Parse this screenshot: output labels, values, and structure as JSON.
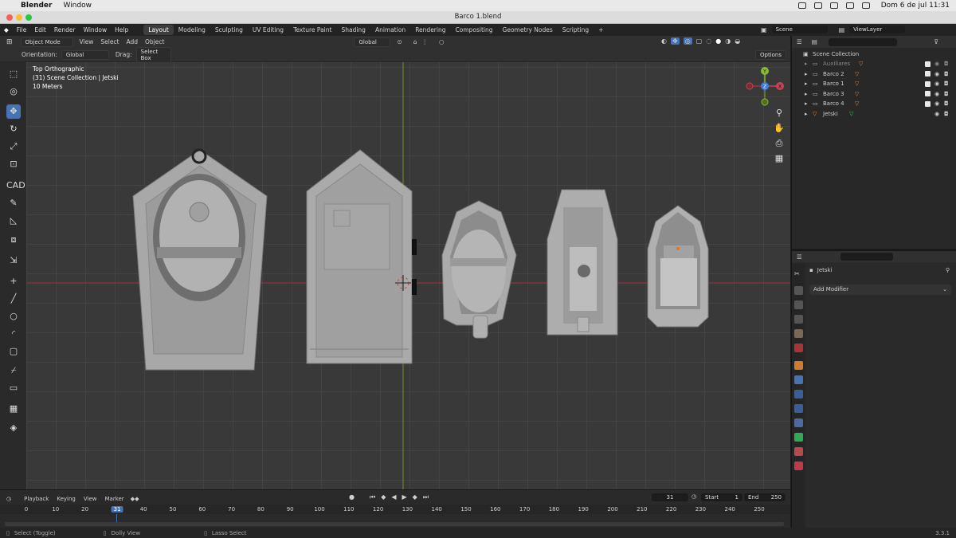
{
  "os_menubar": {
    "app_name": "Blender",
    "menu": "Window",
    "clock": "Dom 6 de jul  11:31"
  },
  "window": {
    "title": "Barco 1.blend"
  },
  "topbar": {
    "menus": [
      "File",
      "Edit",
      "Render",
      "Window",
      "Help"
    ],
    "workspaces": [
      "Layout",
      "Modeling",
      "Sculpting",
      "UV Editing",
      "Texture Paint",
      "Shading",
      "Animation",
      "Rendering",
      "Compositing",
      "Geometry Nodes",
      "Scripting"
    ],
    "active_workspace": "Layout",
    "scene": "Scene",
    "view_layer": "ViewLayer"
  },
  "viewport_header": {
    "mode": "Object Mode",
    "menus": [
      "View",
      "Select",
      "Add",
      "Object"
    ],
    "transform_orientation": "Global",
    "orientation_label": "Orientation:",
    "orientation_value": "Global",
    "drag_label": "Drag:",
    "drag_value": "Select Box",
    "options": "Options"
  },
  "viewport_overlay": {
    "view_name": "Top Orthographic",
    "collection": "(31) Scene Collection | Jetski",
    "scale": "10 Meters"
  },
  "gizmo": {
    "y": "Y",
    "z": "Z",
    "x": "X"
  },
  "outliner": {
    "root": "Scene Collection",
    "items": [
      {
        "name": "Auxiliares",
        "type": "collection"
      },
      {
        "name": "Barco 2",
        "type": "object"
      },
      {
        "name": "Barco 1",
        "type": "object"
      },
      {
        "name": "Barco 3",
        "type": "object"
      },
      {
        "name": "Barco 4",
        "type": "object"
      },
      {
        "name": "Jetski",
        "type": "object"
      }
    ]
  },
  "properties": {
    "object_name": "Jetski",
    "add_modifier": "Add Modifier"
  },
  "timeline": {
    "menus": [
      "Playback",
      "Keying",
      "View",
      "Marker"
    ],
    "current_frame": "31",
    "start_label": "Start",
    "start": "1",
    "end_label": "End",
    "end": "250",
    "ruler_ticks": [
      "0",
      "10",
      "20",
      "31",
      "40",
      "50",
      "60",
      "70",
      "80",
      "90",
      "100",
      "110",
      "120",
      "130",
      "140",
      "150",
      "160",
      "170",
      "180",
      "190",
      "200",
      "210",
      "220",
      "230",
      "240",
      "250"
    ]
  },
  "statusbar": {
    "left": "Select (Toggle)",
    "middle": "Dolly View",
    "right": "Lasso Select",
    "version": "3.3.1"
  },
  "colors": {
    "accent": "#4772b3",
    "x_axis": "#c8434e",
    "y_axis": "#8ab837",
    "z_axis": "#3d7de0",
    "viewport_bg": "#393939"
  }
}
